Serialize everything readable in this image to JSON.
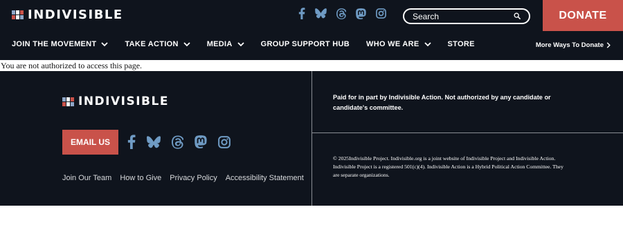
{
  "header": {
    "logo_text": "INDIVISIBLE",
    "social_icons": [
      "facebook-icon",
      "bluesky-icon",
      "threads-icon",
      "mastodon-icon",
      "instagram-icon"
    ],
    "search": {
      "placeholder": "Search"
    },
    "donate_label": "DONATE",
    "nav": {
      "items": [
        {
          "label": "JOIN THE MOVEMENT",
          "has_dropdown": true
        },
        {
          "label": "TAKE ACTION",
          "has_dropdown": true
        },
        {
          "label": "MEDIA",
          "has_dropdown": true
        },
        {
          "label": "GROUP SUPPORT HUB",
          "has_dropdown": false
        },
        {
          "label": "WHO WE ARE",
          "has_dropdown": true
        },
        {
          "label": "STORE",
          "has_dropdown": false
        }
      ],
      "more_ways_label": "More Ways To Donate"
    }
  },
  "main": {
    "message": "You are not authorized to access this page."
  },
  "footer": {
    "logo_text": "INDIVISIBLE",
    "email_label": "EMAIL US",
    "social_icons": [
      "facebook-icon",
      "bluesky-icon",
      "threads-icon",
      "mastodon-icon",
      "instagram-icon"
    ],
    "links": [
      "Join Our Team",
      "How to Give",
      "Privacy Policy",
      "Accessibility Statement"
    ],
    "paid_for": "Paid for in part by Indivisible Action. Not authorized by any candidate or candidate's committee.",
    "copyright": "© 2025Indivisible Project. Indivisible.org is a joint website of Indivisible Project and Indivisible Action. Indivisible Project is a registered 501(c)(4). Indivisible Action is a Hybrid Political Action Committee. They are separate organizations."
  },
  "colors": {
    "background_dark": "#0f141d",
    "accent_red": "#c9524a",
    "icon_blue": "#6f9bc4",
    "logo_blue": "#8fa7c8",
    "logo_red": "#c9524a",
    "white": "#ffffff"
  }
}
